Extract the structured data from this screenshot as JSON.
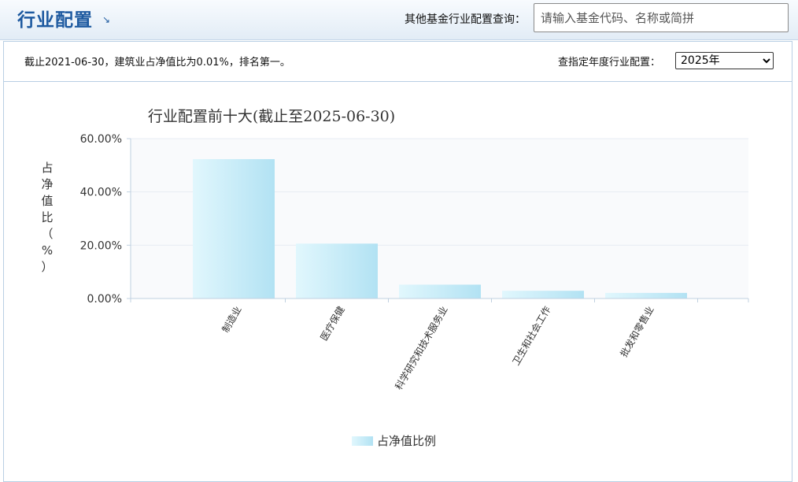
{
  "header": {
    "title": "行业配置",
    "title_icon": "corner-arrow-icon",
    "search_label": "其他基金行业配置查询：",
    "search_placeholder": "请输入基金代码、名称或简拼"
  },
  "info": {
    "text": "截止2021-06-30，建筑业占净值比为0.01%，排名第一。",
    "year_label": "查指定年度行业配置：",
    "year_selected": "2025年"
  },
  "colors": {
    "accent": "#1e5aa0",
    "bar": "#c8eef8",
    "plot_bg": "#f9fafc"
  },
  "chart_data": {
    "type": "bar",
    "title": "行业配置前十大(截止至2025-06-30)",
    "ylabel": "占净值比（%）",
    "xlabel": "",
    "ylim": [
      0,
      60
    ],
    "yticks": [
      0,
      20,
      40,
      60
    ],
    "ytick_labels": [
      "0.00%",
      "20.00%",
      "40.00%",
      "60.00%"
    ],
    "categories": [
      "制造业",
      "医疗保健",
      "科学研究和技术服务业",
      "卫生和社会工作",
      "批发和零售业"
    ],
    "series": [
      {
        "name": "占净值比例",
        "values": [
          52.3,
          20.6,
          5.2,
          2.9,
          2.1
        ]
      }
    ],
    "legend": "bottom-center",
    "grid": true
  }
}
